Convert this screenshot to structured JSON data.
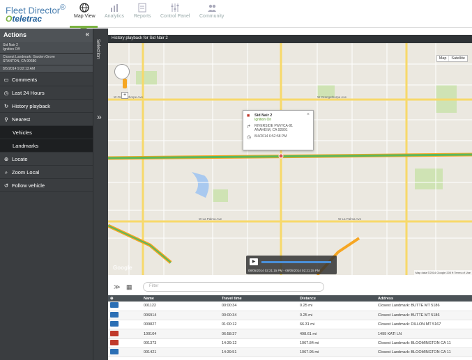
{
  "app": {
    "brand_line1": "Fleet Director",
    "brand_reg": "®",
    "brand_line2a": "O",
    "brand_line2b": "teletrac"
  },
  "nav": [
    {
      "label": "Map View",
      "icon": "globe-icon",
      "active": true
    },
    {
      "label": "Analytics",
      "icon": "bar-chart-icon"
    },
    {
      "label": "Reports",
      "icon": "report-icon"
    },
    {
      "label": "Control Panel",
      "icon": "sliders-icon"
    },
    {
      "label": "Community",
      "icon": "people-icon"
    }
  ],
  "sidebar": {
    "title": "Actions",
    "collapse_icon": "«",
    "vehicle_name": "Sid Nair 2",
    "vehicle_status": "Ignition Off",
    "landmark": "Closest Landmark: Garden Grove",
    "landmark_city": "STANTON, CA 90680",
    "timestamp": "8/5/2014 9:22:13 AM",
    "items": [
      {
        "label": "Comments",
        "icon": "comment-icon"
      },
      {
        "label": "Last 24 Hours",
        "icon": "clock-icon"
      },
      {
        "label": "History playback",
        "icon": "history-icon"
      },
      {
        "label": "Nearest",
        "icon": "pin-icon"
      },
      {
        "label": "Vehicles",
        "sub": true
      },
      {
        "label": "Landmarks",
        "sub": true
      },
      {
        "label": "Locate",
        "icon": "locate-icon"
      },
      {
        "label": "Zoom Local",
        "icon": "zoom-icon"
      },
      {
        "label": "Follow vehicle",
        "icon": "follow-icon"
      }
    ]
  },
  "selection": {
    "label": "Selection",
    "arrow": "»"
  },
  "map": {
    "title": "History playback for Sid Nair 2",
    "options": "Options",
    "map_btn": "Map",
    "sat_btn": "Satellite",
    "roads_h": [
      "W Orangethorpe Ave",
      "W La Palma Ave",
      "W Lincoln Ave",
      "W Broadway",
      "W Ball Rd"
    ],
    "roads_v": [
      "N Euclid St",
      "N Brookhurst St",
      "N Magnolia Ave",
      "N Harbor Blvd"
    ],
    "popup": {
      "name": "Sid Nair 2",
      "status": "Ignition On",
      "address1": "RIVERSIDE FWY/CA-91",
      "address2": "ANAHEIM, CA 92801",
      "time": "8/4/2014 6:52:58 PM",
      "close": "×"
    },
    "playback_range": "08/05/2014 02:21:15 PM - 08/05/2014 02:21:15 PM",
    "google": "Google",
    "credit": "Map data ©2014 Google  200 ft  Terms of Use"
  },
  "list": {
    "filter_placeholder": "Filter",
    "columns": [
      "Name",
      "Travel time",
      "Distance",
      "Address"
    ],
    "rows": [
      {
        "icon": "tow-truck-icon",
        "name": "001122",
        "time": "00:00:34",
        "dist": "0.25 mi",
        "addr": "Closest Landmark: BUTTE MT 5186",
        "color": "#2b6fb5"
      },
      {
        "icon": "truck-icon",
        "name": "006914",
        "time": "00:00:34",
        "dist": "0.25 mi",
        "addr": "Closest Landmark: BUTTE MT 5186",
        "color": "#2b6fb5"
      },
      {
        "icon": "truck-icon",
        "name": "009827",
        "time": "01:00:12",
        "dist": "66.31 mi",
        "addr": "Closest Landmark: DILLON MT 5167",
        "color": "#2b6fb5"
      },
      {
        "icon": "tow-truck-icon",
        "name": "100104",
        "time": "06:58:37",
        "dist": "498.61 mi",
        "addr": "1499 KATI LN",
        "color": "#c0392b"
      },
      {
        "icon": "truck-icon",
        "name": "001373",
        "time": "14:39:12",
        "dist": "1067.84 mi",
        "addr": "Closest Landmark: BLOOMINGTON CA 11",
        "color": "#c0392b"
      },
      {
        "icon": "truck-icon",
        "name": "001421",
        "time": "14:39:51",
        "dist": "1067.95 mi",
        "addr": "Closest Landmark: BLOOMINGTON CA 11",
        "color": "#2b6fb5"
      }
    ]
  }
}
